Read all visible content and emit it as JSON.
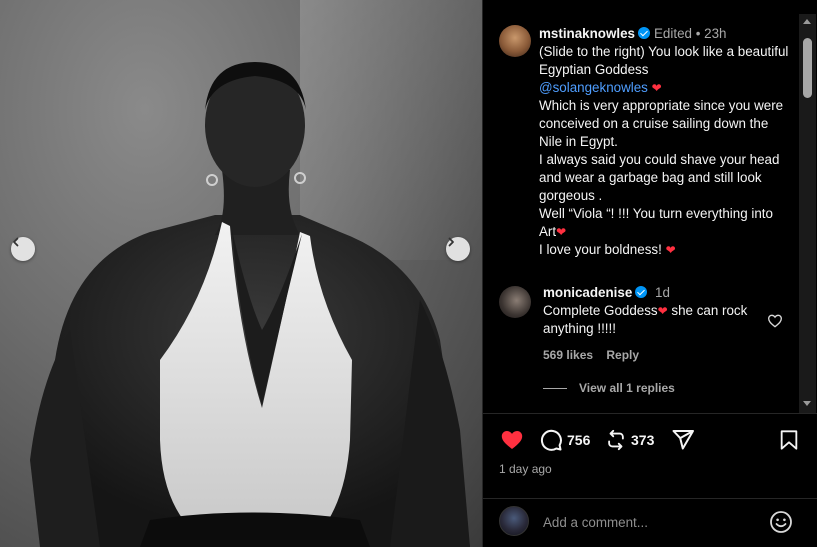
{
  "post": {
    "nav_prev_icon": "chevron-left-icon",
    "nav_next_icon": "chevron-right-icon"
  },
  "caption": {
    "username": "mstinaknowles",
    "edited": "Edited",
    "separator": "•",
    "time": "23h",
    "line1": "(Slide to the right)  You look like a beautiful Egyptian Goddess",
    "mention": "@solangeknowles",
    "line2": "Which is very appropriate since you were conceived on a cruise sailing down the Nile in Egypt.",
    "line3": "I always said you could shave your head and wear a garbage bag and still look gorgeous .",
    "line4": "Well “Viola “! !!! You turn everything into Art",
    "line5": "I love your boldness!"
  },
  "reply": {
    "username": "monicadenise",
    "time": "1d",
    "text_before": "Complete Goddess",
    "text_after": " she can rock anything !!!!!",
    "likes": "569 likes",
    "reply_label": "Reply",
    "view_replies": "View all 1 replies"
  },
  "actions": {
    "likes_count": "756",
    "reposts_count": "373",
    "time_ago": "1 day ago"
  },
  "composer": {
    "placeholder": "Add a comment..."
  },
  "colors": {
    "like_red": "#ff3040",
    "verified_blue": "#0095f6",
    "mention_blue": "#4f9eff"
  }
}
